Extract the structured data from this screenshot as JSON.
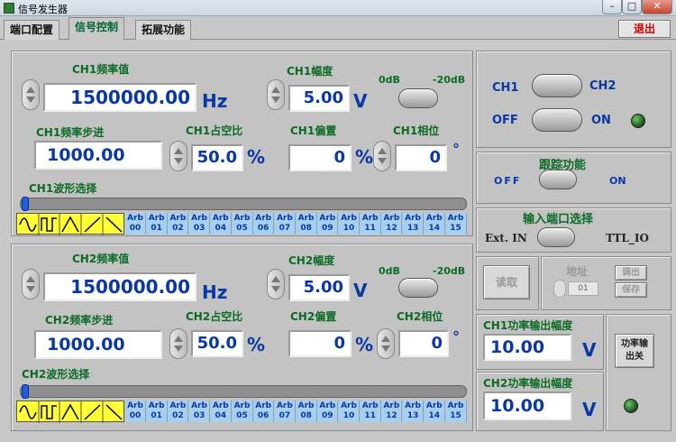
{
  "window": {
    "title": "信号发生器",
    "close": "✕",
    "max": "□",
    "min": "–"
  },
  "tabs": [
    {
      "label": "端口配置"
    },
    {
      "label": "信号控制"
    },
    {
      "label": "拓展功能"
    }
  ],
  "exit_label": "退出",
  "ch1": {
    "freq_label": "CH1频率值",
    "freq": "1500000.00",
    "freq_unit": "Hz",
    "amp_label": "CH1幅度",
    "amp": "5.00",
    "amp_unit": "V",
    "db0": "0dB",
    "db20": "-20dB",
    "step_label": "CH1频率步进",
    "step": "1000.00",
    "duty_label": "CH1占空比",
    "duty": "50.0",
    "duty_unit": "%",
    "offset_label": "CH1偏置",
    "offset": "0",
    "offset_unit": "%",
    "phase_label": "CH1相位",
    "phase": "0",
    "phase_unit": "°",
    "wave_label": "CH1波形选择"
  },
  "ch2": {
    "freq_label": "CH2频率值",
    "freq": "1500000.00",
    "freq_unit": "Hz",
    "amp_label": "CH2幅度",
    "amp": "5.00",
    "amp_unit": "V",
    "db0": "0dB",
    "db20": "-20dB",
    "step_label": "CH2频率步进",
    "step": "1000.00",
    "duty_label": "CH2占空比",
    "duty": "50.0",
    "duty_unit": "%",
    "offset_label": "CH2偏置",
    "offset": "0",
    "offset_unit": "%",
    "phase_label": "CH2相位",
    "phase": "0",
    "phase_unit": "°",
    "wave_label": "CH2波形选择"
  },
  "arb": [
    "00",
    "01",
    "02",
    "03",
    "04",
    "05",
    "06",
    "07",
    "08",
    "09",
    "10",
    "11",
    "12",
    "13",
    "14",
    "15"
  ],
  "arb_prefix": "Arb",
  "right": {
    "ch1": "CH1",
    "ch2": "CH2",
    "off": "OFF",
    "on": "ON",
    "track_label": "跟踪功能",
    "track_off": "OFF",
    "track_on": "ON",
    "port_label": "输入端口选择",
    "ext_in": "Ext. IN",
    "ttl_io": "TTL_IO",
    "read": "读取",
    "addr_label": "地址",
    "addr_value": "01",
    "call": "调出",
    "save": "保存",
    "p1_label": "CH1功率输出幅度",
    "p1_value": "10.00",
    "p1_unit": "V",
    "p2_label": "CH2功率输出幅度",
    "p2_value": "10.00",
    "p2_unit": "V",
    "power_switch": "功率输出关"
  },
  "colors": {
    "accent_green": "#0c6b25",
    "value_blue": "#0a37a6",
    "wave_yellow": "#ffff33",
    "arb_blue": "#a8d0ee"
  }
}
